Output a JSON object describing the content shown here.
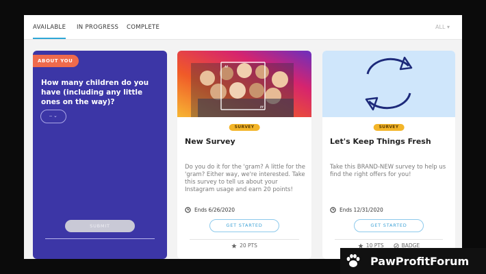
{
  "tabs": [
    {
      "label": "AVAILABLE",
      "active": true
    },
    {
      "label": "IN PROGRESS",
      "active": false
    },
    {
      "label": "COMPLETE",
      "active": false
    }
  ],
  "filter": {
    "label": "ALL ▾"
  },
  "about_card": {
    "badge": "ABOUT YOU",
    "question": "How many children do you have (including any little ones on the way)?",
    "select_value": "– ⌄",
    "submit_label": "SUBMIT"
  },
  "surveys": [
    {
      "tag": "SURVEY",
      "title": "New Survey",
      "description": "Do you do it for the 'gram? A little for the 'gram? Either way, we're interested. Take this survey to tell us about your Instagram usage and earn 20 points!",
      "ends": "Ends 6/26/2020",
      "cta": "GET STARTED",
      "points": "20 PTS"
    },
    {
      "tag": "SURVEY",
      "title": "Let's Keep Things Fresh",
      "description": "Take this BRAND-NEW survey to help us find the right offers for you!",
      "ends": "Ends 12/31/2020",
      "cta": "GET STARTED",
      "points": "10 PTS",
      "badge": "BADGE"
    }
  ],
  "watermark": {
    "text": "PawProfitForum"
  },
  "colors": {
    "accent": "#2ea6d6",
    "about_bg": "#3c36a6",
    "about_badge": "#ef6a4c",
    "survey_tag": "#f3b529",
    "refresh_bg": "#cfe6fb"
  }
}
